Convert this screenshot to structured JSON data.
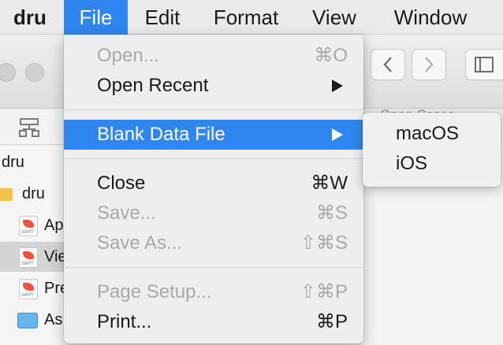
{
  "menubar": {
    "app": "dru",
    "file": "File",
    "edit": "Edit",
    "format": "Format",
    "view": "View",
    "window": "Window"
  },
  "file_menu": {
    "open": {
      "label": "Open...",
      "shortcut": "⌘O",
      "enabled": false
    },
    "open_recent": {
      "label": "Open Recent",
      "submenu": true
    },
    "blank_data_file": {
      "label": "Blank Data File",
      "submenu": true,
      "highlighted": true
    },
    "close": {
      "label": "Close",
      "shortcut": "⌘W",
      "enabled": true
    },
    "save": {
      "label": "Save...",
      "shortcut": "⌘S",
      "enabled": false
    },
    "save_as": {
      "label": "Save As...",
      "shortcut": "⇧⌘S",
      "enabled": false
    },
    "page_setup": {
      "label": "Page Setup...",
      "shortcut": "⇧⌘P",
      "enabled": false
    },
    "print": {
      "label": "Print...",
      "shortcut": "⌘P",
      "enabled": true
    }
  },
  "submenu": {
    "items": [
      "macOS",
      "iOS"
    ]
  },
  "window": {
    "tab_hint": "Open Cases",
    "sidebar": {
      "root": "dru",
      "folder": "dru",
      "files": [
        {
          "label": "Ap",
          "type": "swift",
          "selected": false
        },
        {
          "label": "Vie",
          "type": "swift",
          "selected": true
        },
        {
          "label": "Pre",
          "type": "swift",
          "selected": false
        },
        {
          "label": "As",
          "type": "xcassets",
          "selected": false
        }
      ],
      "swift_badge": "SWIFT"
    }
  },
  "colors": {
    "accent": "#2f86ee",
    "disabled_text": "#a9a9a9",
    "menu_bg": "#eeeeee"
  }
}
